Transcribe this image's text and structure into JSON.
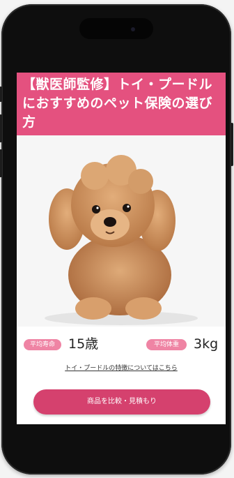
{
  "article": {
    "title": "【獣医師監修】トイ・プードルにおすすめのペット保険の選び方"
  },
  "stats": {
    "lifespan_label": "平均寿命",
    "lifespan_value": "15歳",
    "weight_label": "平均体重",
    "weight_value": "3kg"
  },
  "links": {
    "breed_info": "トイ・プードルの特徴についてはこちら"
  },
  "cta": {
    "label": "商品を比較・見積もり"
  },
  "colors": {
    "accent": "#e4517f",
    "pill": "#ef84a4",
    "button": "#d5416e"
  }
}
